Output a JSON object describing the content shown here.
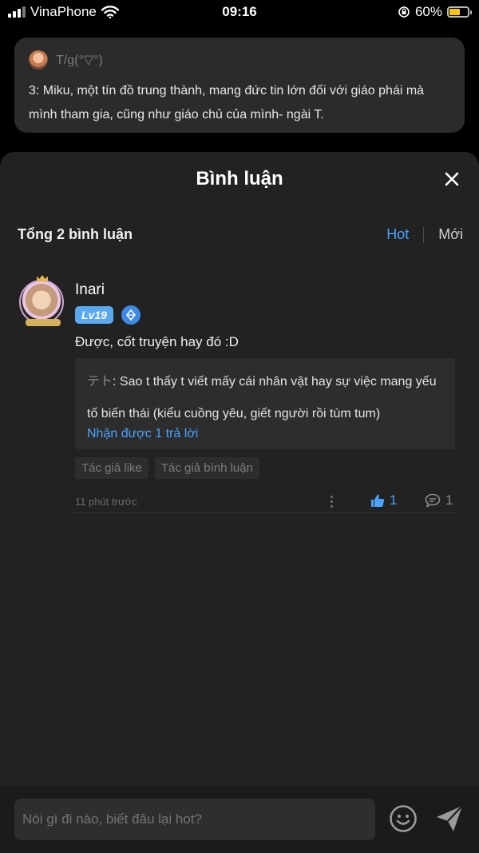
{
  "status_bar": {
    "carrier": "VinaPhone",
    "time": "09:16",
    "battery_percent": "60%",
    "battery_level": 0.6
  },
  "post": {
    "author": "T/g(°▽°)",
    "text": "3: Miku, một tín đồ trung thành, mang đức tin lớn đối với giáo phái mà mình tham gia, cũng như giáo chủ của mình- ngài T."
  },
  "sheet": {
    "title": "Bình luận",
    "summary": "Tổng 2 bình luận",
    "sort_hot": "Hot",
    "sort_new": "Mới"
  },
  "comment": {
    "name": "Inari",
    "level": "Lv19",
    "text": "Được, cốt truyện hay đó :D",
    "reply": {
      "author": "テト",
      "text": ": Sao t thấy t viết mấy cái nhân vật hay sự việc mang yếu tố biến thái (kiểu cuồng yêu, giết người rồi tùm tum)",
      "more": "Nhận được 1 trả lời"
    },
    "tags": [
      "Tác giả like",
      "Tác giả bình luận"
    ],
    "time": "11 phút trước",
    "likes": "1",
    "replies": "1"
  },
  "input": {
    "placeholder": "Nói gì đi nào, biết đâu lại hot?"
  },
  "colors": {
    "accent": "#4aa3ff",
    "sheet_bg": "#222222",
    "battery": "#f6c513"
  }
}
